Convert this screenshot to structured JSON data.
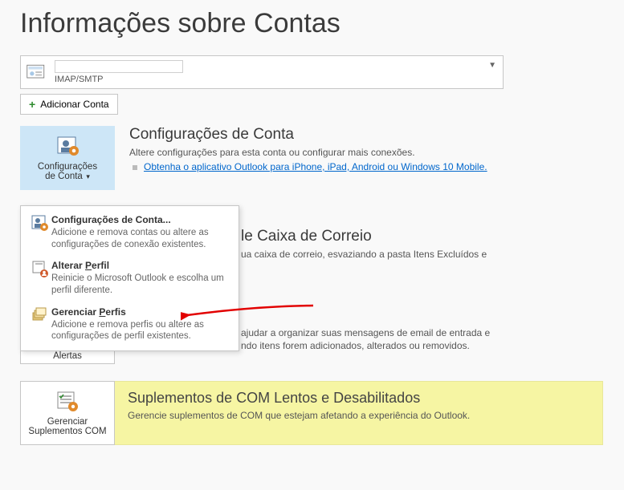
{
  "pageTitle": "Informações sobre Contas",
  "account": {
    "protocol": "IMAP/SMTP"
  },
  "addAccountLabel": "Adicionar Conta",
  "configButton": {
    "line1": "Configurações",
    "line2": "de Conta"
  },
  "configSection": {
    "title": "Configurações de Conta",
    "desc": "Altere configurações para esta conta ou configurar mais conexões.",
    "link": "Obtenha o aplicativo Outlook para iPhone, iPad, Android ou Windows 10 Mobile."
  },
  "mailboxSection": {
    "titleVisible": "le Caixa de Correio",
    "line1": "ua caixa de correio, esvaziando a pasta Itens Excluídos e",
    "line2a": "ajudar a organizar suas mensagens de email de entrada e",
    "line2b": "ndo itens forem adicionados, alterados ou removidos."
  },
  "menu": {
    "items": [
      {
        "title": "Configurações de Conta...",
        "desc": "Adicione e remova contas ou altere as configurações de conexão existentes."
      },
      {
        "title": "Alterar Perfil",
        "desc": "Reinicie o Microsoft Outlook e escolha um perfil diferente."
      },
      {
        "title": "Gerenciar Perfis",
        "desc": "Adicione e remova perfis ou altere as configurações de perfil existentes."
      }
    ]
  },
  "alertasLabel": "Alertas",
  "comButton": {
    "line1": "Gerenciar",
    "line2": "Suplementos COM"
  },
  "comSection": {
    "title": "Suplementos de COM Lentos e Desabilitados",
    "desc": "Gerencie suplementos de COM que estejam afetando a experiência do Outlook."
  }
}
